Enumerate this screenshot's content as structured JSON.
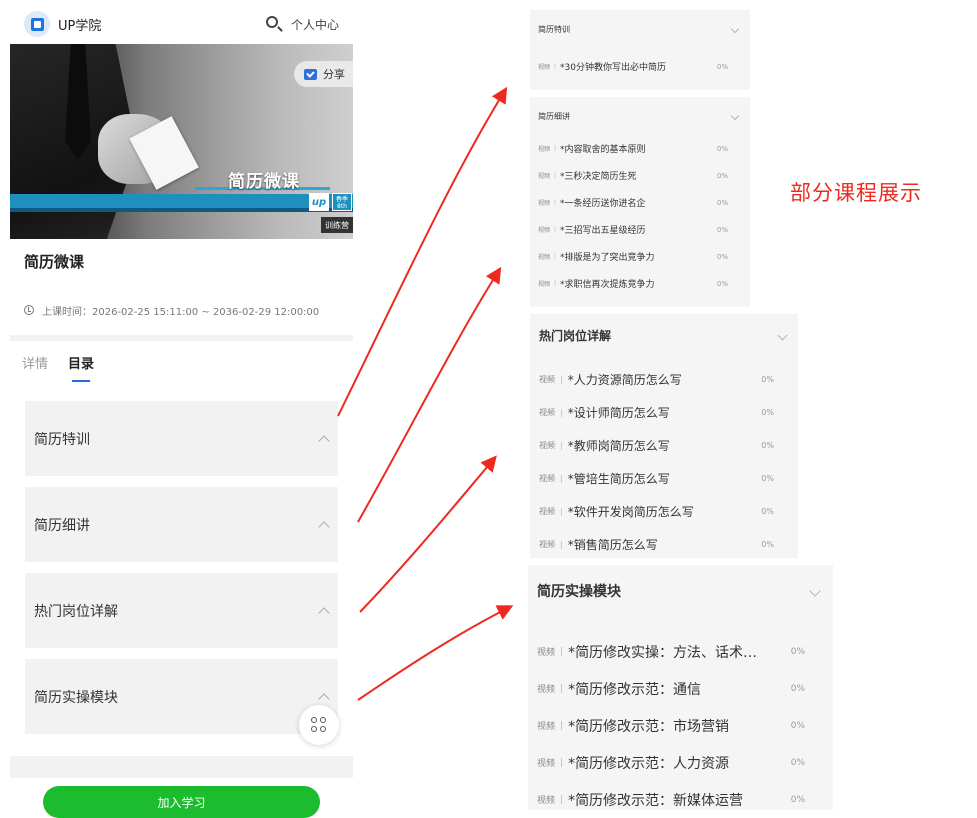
{
  "header": {
    "app_name": "UP学院",
    "personal_center": "个人中心"
  },
  "banner": {
    "title": "简历微课",
    "share_label": "分享",
    "badge_up": "up",
    "badge_date": "春季 8th",
    "badge_camp": "训练营"
  },
  "course": {
    "title": "简历微课",
    "schedule": "上课时间：2026-02-25 15:11:00 ~ 2036-02-29 12:00:00"
  },
  "tabs": [
    {
      "label": "详情"
    },
    {
      "label": "目录"
    }
  ],
  "categories": [
    {
      "label": "简历特训"
    },
    {
      "label": "简历细讲"
    },
    {
      "label": "热门岗位详解"
    },
    {
      "label": "简历实操模块"
    }
  ],
  "join_button": "加入学习",
  "caption": "部分课程展示",
  "panels": [
    {
      "title": "简历特训",
      "lessons": [
        {
          "tag": "视频",
          "name": "*30分钟教你写出必中简历",
          "progress": "0%"
        }
      ]
    },
    {
      "title": "简历细讲",
      "lessons": [
        {
          "tag": "视频",
          "name": "*内容取舍的基本原则",
          "progress": "0%"
        },
        {
          "tag": "视频",
          "name": "*三秒决定简历生死",
          "progress": "0%"
        },
        {
          "tag": "视频",
          "name": "*一条经历送你进名企",
          "progress": "0%"
        },
        {
          "tag": "视频",
          "name": "*三招写出五星级经历",
          "progress": "0%"
        },
        {
          "tag": "视频",
          "name": "*排版是为了突出竞争力",
          "progress": "0%"
        },
        {
          "tag": "视频",
          "name": "*求职信再次提炼竞争力",
          "progress": "0%"
        }
      ]
    },
    {
      "title": "热门岗位详解",
      "lessons": [
        {
          "tag": "视频",
          "name": "*人力资源简历怎么写",
          "progress": "0%"
        },
        {
          "tag": "视频",
          "name": "*设计师简历怎么写",
          "progress": "0%"
        },
        {
          "tag": "视频",
          "name": "*教师岗简历怎么写",
          "progress": "0%"
        },
        {
          "tag": "视频",
          "name": "*管培生简历怎么写",
          "progress": "0%"
        },
        {
          "tag": "视频",
          "name": "*软件开发岗简历怎么写",
          "progress": "0%"
        },
        {
          "tag": "视频",
          "name": "*销售简历怎么写",
          "progress": "0%"
        }
      ]
    },
    {
      "title": "简历实操模块",
      "lessons": [
        {
          "tag": "视频",
          "name": "*简历修改实操：方法、话术…",
          "progress": "0%"
        },
        {
          "tag": "视频",
          "name": "*简历修改示范：通信",
          "progress": "0%"
        },
        {
          "tag": "视频",
          "name": "*简历修改示范：市场营销",
          "progress": "0%"
        },
        {
          "tag": "视频",
          "name": "*简历修改示范：人力资源",
          "progress": "0%"
        },
        {
          "tag": "视频",
          "name": "*简历修改示范：新媒体运营",
          "progress": "0%"
        }
      ]
    }
  ],
  "colors": {
    "accent": "#1c6fe0",
    "join_button": "#1bbd2f",
    "arrow": "#ee2a1e",
    "caption": "#ee2a1e"
  }
}
